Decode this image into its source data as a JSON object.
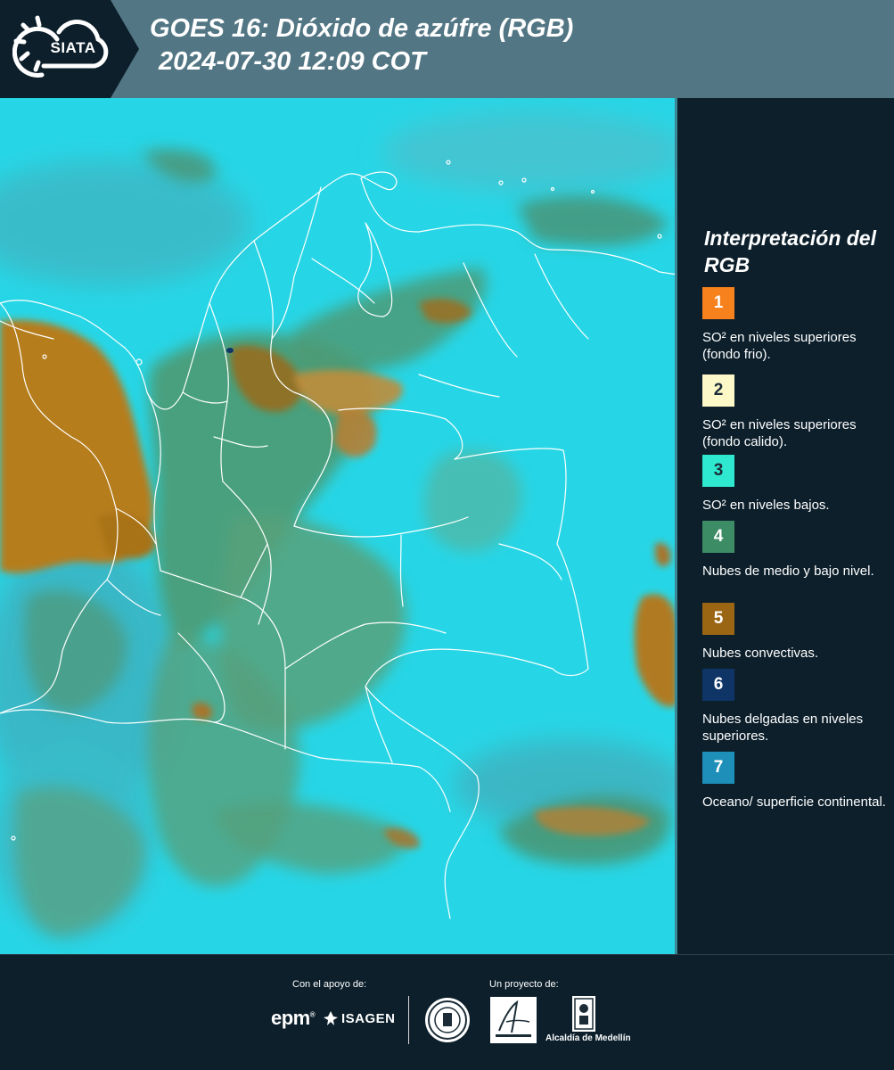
{
  "header": {
    "logo_text": "SIATA",
    "title_line1": "GOES 16: Dióxido de azúfre (RGB)",
    "title_line2": "2024-07-30 12:09 COT"
  },
  "legend": {
    "title": "Interpretación del RGB",
    "items": [
      {
        "number": "1",
        "color": "#f7811c",
        "text_color": "#ffffff",
        "label": "SO² en niveles superiores (fondo frio)."
      },
      {
        "number": "2",
        "color": "#fdf8c8",
        "text_color": "#1b2c36",
        "label": "SO² en niveles superiores (fondo calido)."
      },
      {
        "number": "3",
        "color": "#2ee8d0",
        "text_color": "#1b2c36",
        "label": "SO² en niveles bajos."
      },
      {
        "number": "4",
        "color": "#3c8c66",
        "text_color": "#ffffff",
        "label": "Nubes de medio y bajo nivel."
      },
      {
        "number": "5",
        "color": "#9b6614",
        "text_color": "#ffffff",
        "label": "Nubes convectivas."
      },
      {
        "number": "6",
        "color": "#0e3566",
        "text_color": "#ffffff",
        "label": "Nubes delgadas en niveles superiores."
      },
      {
        "number": "7",
        "color": "#1d8fb8",
        "text_color": "#ffffff",
        "label": "Oceano/ superficie continental."
      }
    ]
  },
  "footer": {
    "support_label": "Con el apoyo de:",
    "project_label": "Un proyecto de:",
    "epm_text": "epm",
    "isagen_text": "ISAGEN",
    "alcaldia_text": "Alcaldía de Medellín"
  },
  "map": {
    "cyan_background": "#27d6e6",
    "cloud_green": "#3c8c66",
    "cloud_orange": "#b07a1e",
    "border_color": "#ffffff"
  }
}
